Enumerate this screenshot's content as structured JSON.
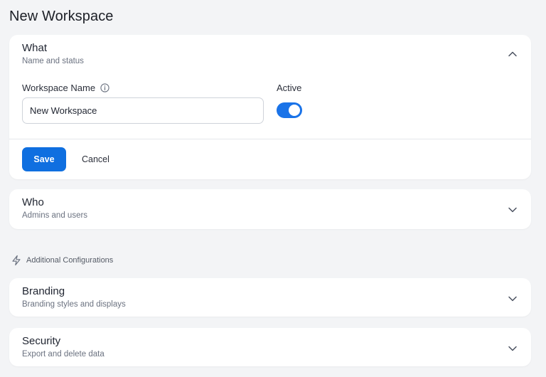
{
  "page": {
    "title": "New Workspace"
  },
  "what": {
    "title": "What",
    "subtitle": "Name and status",
    "workspace_name_label": "Workspace Name",
    "workspace_name_value": "New Workspace",
    "active_label": "Active",
    "active": true,
    "save_label": "Save",
    "cancel_label": "Cancel",
    "expanded": true
  },
  "who": {
    "title": "Who",
    "subtitle": "Admins and users",
    "expanded": false
  },
  "additional": {
    "label": "Additional Configurations",
    "icon": "bolt-icon"
  },
  "branding": {
    "title": "Branding",
    "subtitle": "Branding styles and displays",
    "expanded": false
  },
  "security": {
    "title": "Security",
    "subtitle": "Export and delete data",
    "expanded": false
  },
  "colors": {
    "accent": "#0f6fe0",
    "background": "#f3f4f6",
    "card": "#ffffff"
  }
}
